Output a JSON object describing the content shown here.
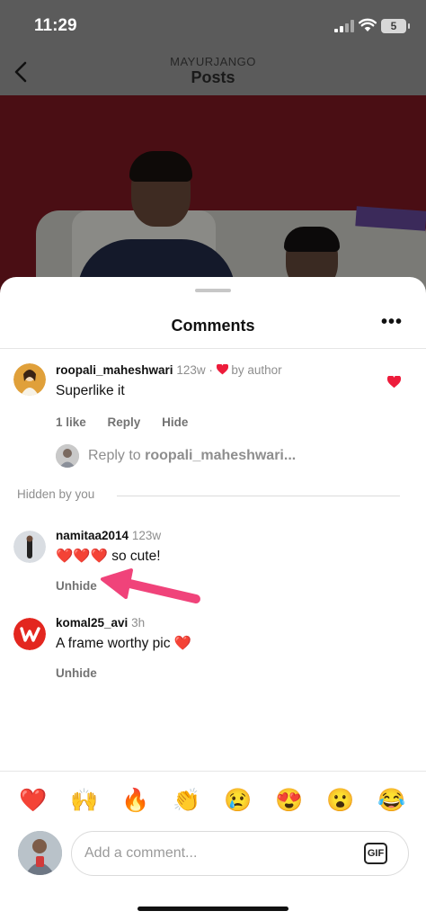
{
  "status_bar": {
    "time": "11:29",
    "battery": "5"
  },
  "header": {
    "username": "MAYURJANGO",
    "title": "Posts"
  },
  "comments_sheet": {
    "title": "Comments",
    "more_icon": "more-horizontal-icon",
    "comments": [
      {
        "username": "roopali_maheshwari",
        "time": "123w",
        "liked_by_author": "by author",
        "text": "Superlike it",
        "likes": "1 like",
        "reply_label": "Reply",
        "hide_label": "Hide"
      }
    ],
    "reply_prompt": {
      "prefix": "Reply to",
      "username": "roopali_maheshwari..."
    },
    "hidden_section_label": "Hidden by you",
    "hidden_comments": [
      {
        "username": "namitaa2014",
        "time": "123w",
        "emoji": "❤️❤️❤️",
        "text": "so cute!",
        "unhide_label": "Unhide"
      },
      {
        "username": "komal25_avi",
        "time": "3h",
        "text": "A frame worthy pic",
        "emoji": "❤️",
        "unhide_label": "Unhide"
      }
    ]
  },
  "emoji_bar": [
    "❤️",
    "🙌",
    "🔥",
    "👏",
    "😢",
    "😍",
    "😮",
    "😂"
  ],
  "composer": {
    "placeholder": "Add a comment...",
    "gif_label": "GIF"
  },
  "colors": {
    "heart": "#ed1c3b",
    "annotation_arrow": "#f0437a",
    "muted_text": "#8e8e8e"
  }
}
